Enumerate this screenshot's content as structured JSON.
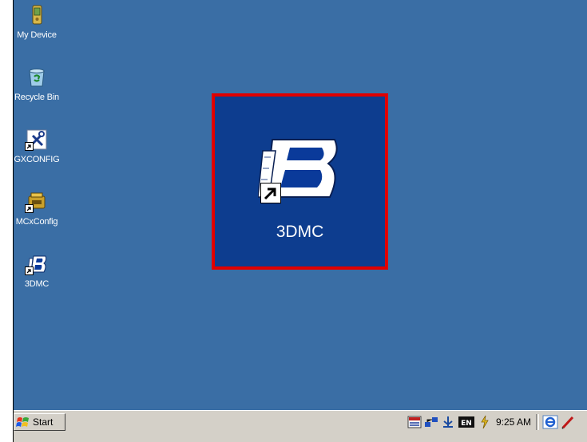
{
  "desktop": {
    "background_color": "#3a6ea5",
    "icons": [
      {
        "label": "My Device",
        "icon": "my-device-icon",
        "shortcut": false
      },
      {
        "label": "Recycle Bin",
        "icon": "recycle-bin-icon",
        "shortcut": false
      },
      {
        "label": "GXCONFIG",
        "icon": "tools-icon",
        "shortcut": true
      },
      {
        "label": "MCxConfig",
        "icon": "mcxconfig-icon",
        "shortcut": true
      },
      {
        "label": "3DMC",
        "icon": "3dmc-icon",
        "shortcut": true
      }
    ]
  },
  "zoom": {
    "label": "3DMC",
    "highlight_color": "#e00000",
    "tile_color": "#0d3d8f",
    "icon": "3dmc-icon"
  },
  "taskbar": {
    "start_label": "Start",
    "clock": "9:25 AM",
    "tray_icons": [
      "input-panel-icon",
      "network-icon",
      "usb-icon",
      "language-en-icon",
      "power-icon"
    ],
    "language": "EN",
    "right_icons": [
      "ie-icon",
      "pen-icon"
    ]
  }
}
